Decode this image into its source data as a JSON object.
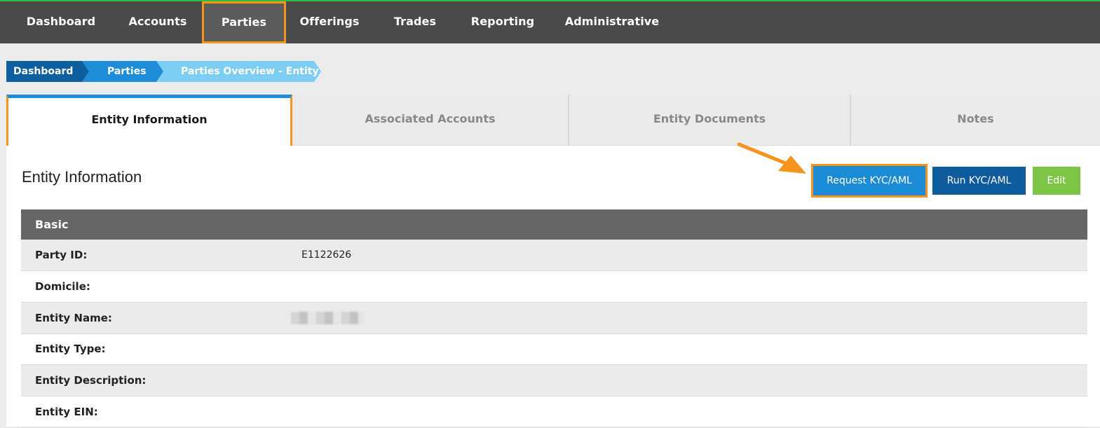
{
  "nav": {
    "items": [
      {
        "label": "Dashboard"
      },
      {
        "label": "Accounts"
      },
      {
        "label": "Parties"
      },
      {
        "label": "Offerings"
      },
      {
        "label": "Trades"
      },
      {
        "label": "Reporting"
      },
      {
        "label": "Administrative"
      }
    ]
  },
  "breadcrumb": [
    "Dashboard",
    "Parties",
    "Parties Overview - Entity"
  ],
  "tabs": [
    {
      "label": "Entity Information"
    },
    {
      "label": "Associated Accounts"
    },
    {
      "label": "Entity Documents"
    },
    {
      "label": "Notes"
    }
  ],
  "section": {
    "title": "Entity Information",
    "buttons": {
      "request": "Request KYC/AML",
      "run": "Run KYC/AML",
      "edit": "Edit"
    }
  },
  "table": {
    "header": "Basic",
    "rows": [
      {
        "label": "Party ID:",
        "value": "E1122626"
      },
      {
        "label": "Domicile:",
        "value": ""
      },
      {
        "label": "Entity Name:",
        "value": ""
      },
      {
        "label": "Entity Type:",
        "value": ""
      },
      {
        "label": "Entity Description:",
        "value": ""
      },
      {
        "label": "Entity EIN:",
        "value": ""
      }
    ]
  },
  "colors": {
    "nav_bg": "#4a4a4a",
    "accent_orange": "#f7941d",
    "accent_green": "#2fbf3a",
    "blue_primary": "#1a8bd4",
    "blue_dark": "#0d5a9c",
    "green_button": "#7dc546"
  },
  "icons": {
    "annotation": "orange-arrow-icon"
  }
}
